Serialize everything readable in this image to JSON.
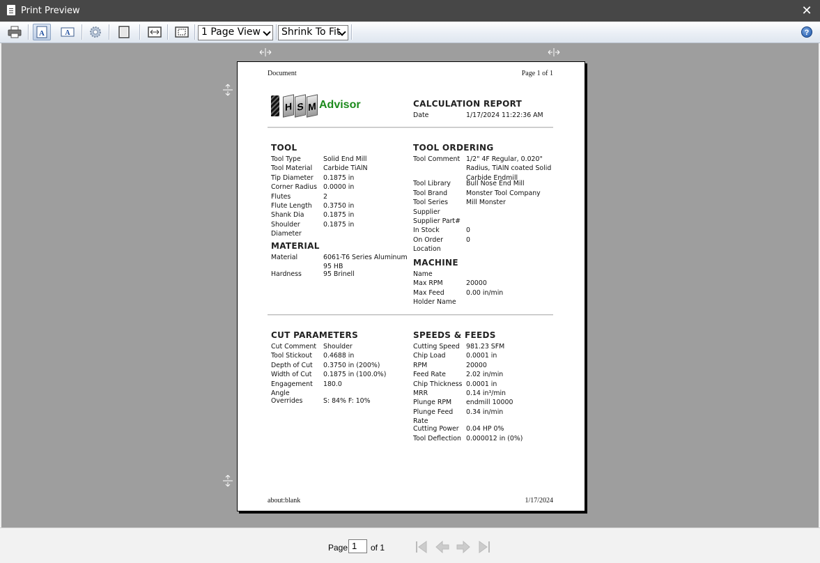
{
  "window": {
    "title": "Print Preview",
    "close_glyph": "✕"
  },
  "toolbar": {
    "buttons": [
      {
        "icon": "printer-icon"
      },
      {
        "icon": "portrait-icon",
        "active": true
      },
      {
        "icon": "landscape-icon"
      },
      {
        "icon": "page-setup-gear-icon"
      },
      {
        "icon": "single-page-icon"
      },
      {
        "icon": "fit-width-icon"
      },
      {
        "icon": "fit-page-icon"
      }
    ],
    "view_select": "1 Page View",
    "scale_select": "Shrink To Fit",
    "help_label": "?"
  },
  "page": {
    "header_left": "Document",
    "header_right": "Page 1 of 1",
    "footer_left": "about:blank",
    "footer_right": "1/17/2024",
    "logo": {
      "letters": [
        "H",
        "S",
        "M"
      ],
      "word": "Advisor"
    },
    "report_title": "CALCULATION REPORT",
    "report_date_label": "Date",
    "report_date": "1/17/2024 11:22:36 AM",
    "tool": {
      "title": "TOOL",
      "rows": [
        {
          "k": "Tool Type",
          "v": "Solid End Mill"
        },
        {
          "k": "Tool Material",
          "v": "Carbide TiAlN"
        },
        {
          "k": "Tip Diameter",
          "v": "0.1875 in"
        },
        {
          "k": "Corner Radius",
          "v": "0.0000 in"
        },
        {
          "k": "Flutes",
          "v": "2"
        },
        {
          "k": "Flute Length",
          "v": "0.3750 in"
        },
        {
          "k": "Shank Dia",
          "v": "0.1875 in"
        },
        {
          "k": "Shoulder\nDiameter",
          "v": "0.1875 in"
        }
      ]
    },
    "material": {
      "title": "MATERIAL",
      "rows": [
        {
          "k": "Material",
          "v": "6061-T6 Series Aluminum\n95 HB"
        },
        {
          "k": "Hardness",
          "v": "95 Brinell"
        }
      ]
    },
    "tool_ordering": {
      "title": "TOOL ORDERING",
      "rows": [
        {
          "k": "Tool Comment",
          "v": "1/2\" 4F Regular, 0.020\"\nRadius, TiAlN coated Solid\nCarbide Endmill"
        },
        {
          "k": "Tool Library",
          "v": "Bull Nose End Mill"
        },
        {
          "k": "Tool Brand",
          "v": "Monster Tool Company"
        },
        {
          "k": "Tool Series",
          "v": "Mill Monster"
        },
        {
          "k": "Supplier",
          "v": ""
        },
        {
          "k": "Supplier Part#",
          "v": ""
        },
        {
          "k": "In Stock",
          "v": "0"
        },
        {
          "k": "On Order",
          "v": "0"
        },
        {
          "k": "Location",
          "v": ""
        }
      ]
    },
    "machine": {
      "title": "MACHINE",
      "rows": [
        {
          "k": "Name",
          "v": ""
        },
        {
          "k": "Max RPM",
          "v": "20000"
        },
        {
          "k": "Max Feed",
          "v": "0.00 in/min"
        },
        {
          "k": "Holder Name",
          "v": ""
        }
      ]
    },
    "cut_parameters": {
      "title": "CUT PARAMETERS",
      "rows": [
        {
          "k": "Cut Comment",
          "v": "Shoulder"
        },
        {
          "k": "Tool Stickout",
          "v": "0.4688 in"
        },
        {
          "k": "Depth of Cut",
          "v": "0.3750 in (200%)"
        },
        {
          "k": "Width of Cut",
          "v": "0.1875 in (100.0%)"
        },
        {
          "k": "Engagement\nAngle",
          "v": "180.0"
        },
        {
          "k": "Overrides",
          "v": "S: 84% F: 10%"
        }
      ]
    },
    "speeds_feeds": {
      "title": "SPEEDS & FEEDS",
      "rows": [
        {
          "k": "Cutting Speed",
          "v": "981.23 SFM"
        },
        {
          "k": "Chip Load",
          "v": "0.0001 in"
        },
        {
          "k": "RPM",
          "v": "20000"
        },
        {
          "k": "Feed Rate",
          "v": "2.02 in/min"
        },
        {
          "k": "Chip Thickness",
          "v": "0.0001 in"
        },
        {
          "k": "MRR",
          "v": "0.14 in³/min"
        },
        {
          "k": "Plunge RPM",
          "v": "endmill 10000"
        },
        {
          "k": "Plunge Feed\nRate",
          "v": "0.34 in/min"
        },
        {
          "k": "Cutting Power",
          "v": "0.04 HP 0%"
        },
        {
          "k": "Tool Deflection",
          "v": "0.000012 in (0%)"
        }
      ]
    }
  },
  "status": {
    "page_label": "Page",
    "page_value": "1",
    "of_label": "of 1",
    "nav": [
      "first-page-icon",
      "prev-page-icon",
      "next-page-icon",
      "last-page-icon"
    ]
  }
}
